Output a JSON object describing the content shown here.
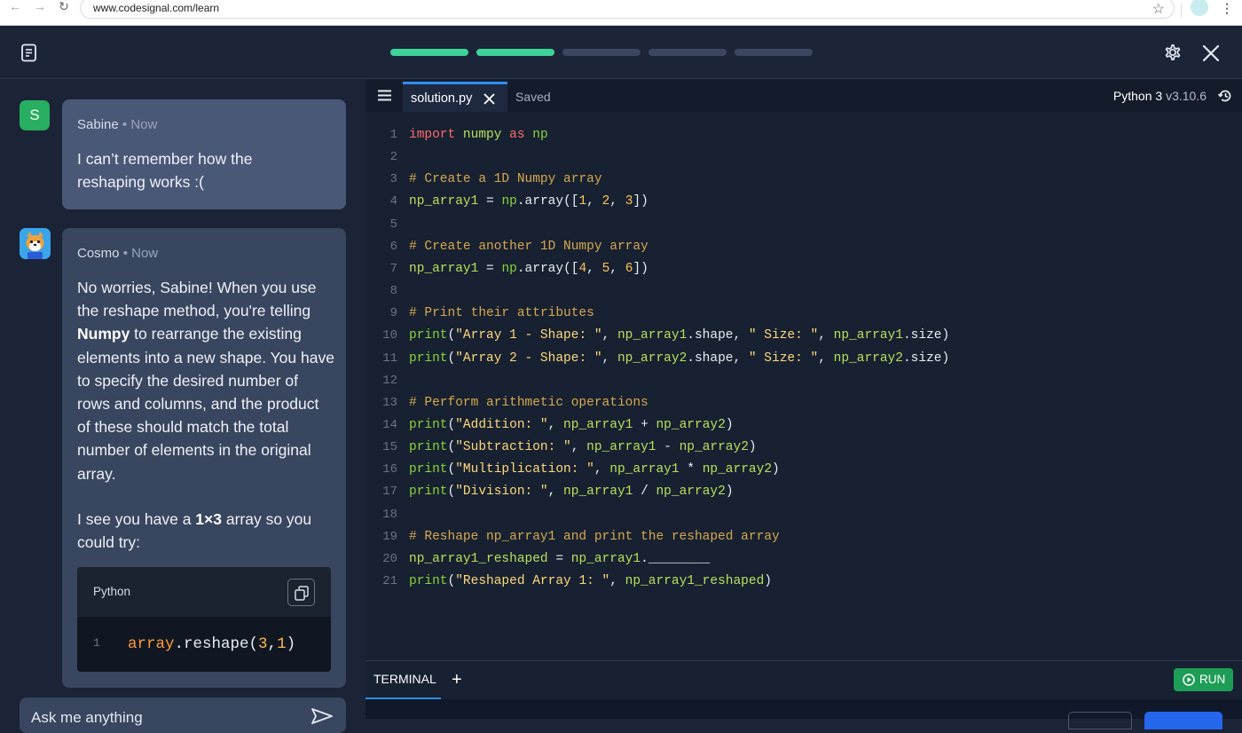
{
  "browser": {
    "url": "www.codesignal.com/learn"
  },
  "header": {
    "progress": {
      "completed": 2,
      "total": 5
    }
  },
  "chat": {
    "user": {
      "avatar_letter": "S",
      "name": "Sabine",
      "time": "Now",
      "message": "I can’t remember how the reshaping works :("
    },
    "bot": {
      "name": "Cosmo",
      "time": "Now",
      "para1_pre": "No worries, Sabine! When you use the reshape method, you're telling ",
      "para1_bold": "Numpy",
      "para1_post": " to rearrange the existing elements into a new shape. You have to specify the desired number of rows and columns, and the product of these should match the total number of elements in the original array.",
      "para2_pre": "I see you have a ",
      "para2_bold": "1×3",
      "para2_post": " array so you could try:",
      "code_lang": "Python",
      "code_line_number": "1",
      "code_obj": "array",
      "code_call": ".reshape(",
      "code_arg1": "3",
      "code_sep": ",",
      "code_arg2": "1",
      "code_close": ")"
    },
    "input_placeholder": "Ask me anything"
  },
  "editor": {
    "file_tab": "solution.py",
    "save_status": "Saved",
    "language": "Python 3",
    "version": "v3.10.6",
    "lines": [
      "import numpy as np",
      "",
      "# Create a 1D Numpy array",
      "np_array1 = np.array([1, 2, 3])",
      "",
      "# Create another 1D Numpy array",
      "np_array1 = np.array([4, 5, 6])",
      "",
      "# Print their attributes",
      "print(\"Array 1 - Shape: \", np_array1.shape, \" Size: \", np_array1.size)",
      "print(\"Array 2 - Shape: \", np_array2.shape, \" Size: \", np_array2.size)",
      "",
      "# Perform arithmetic operations",
      "print(\"Addition: \", np_array1 + np_array2)",
      "print(\"Subtraction: \", np_array1 - np_array2)",
      "print(\"Multiplication: \", np_array1 * np_array2)",
      "print(\"Division: \", np_array1 / np_array2)",
      "",
      "# Reshape np_array1 and print the reshaped array",
      "np_array1_reshaped = np_array1.________",
      "print(\"Reshaped Array 1: \", np_array1_reshaped)"
    ],
    "terminal_tab": "TERMINAL",
    "run_label": "RUN"
  },
  "icons": {
    "notes": "notes-icon",
    "settings": "gear-icon",
    "close": "close-icon",
    "copy": "copy-icon",
    "send": "send-icon",
    "menu": "hamburger-icon",
    "history": "history-icon",
    "run": "play-circle-icon"
  },
  "colors": {
    "progress_done": "#3fd39a",
    "run_button": "#1e9d57",
    "tab_accent": "#2e8df0"
  }
}
